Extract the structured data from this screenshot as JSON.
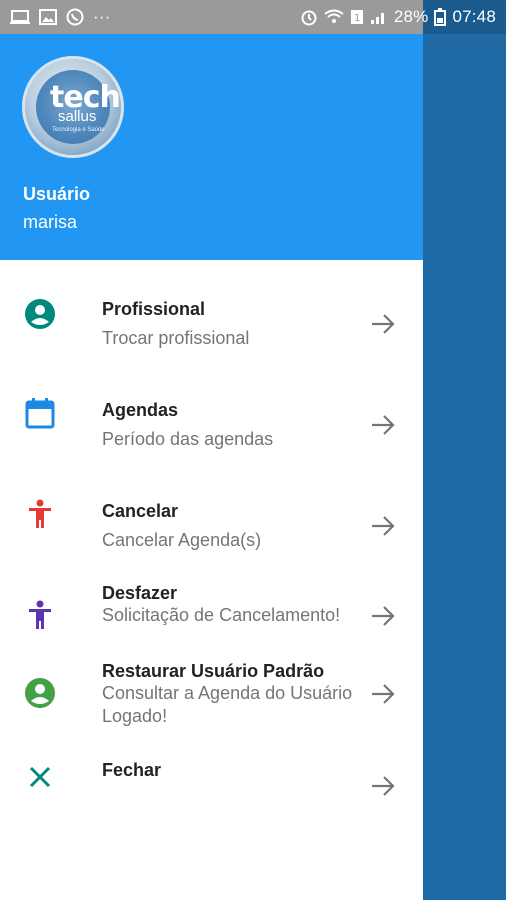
{
  "status_bar": {
    "battery": "28%",
    "time": "07:48",
    "more": "···"
  },
  "header": {
    "logo": {
      "tech": "tech",
      "sallus": "sallus",
      "tagline": "Tecnologia e Saúde"
    },
    "user_label": "Usuário",
    "user_name": "marisa"
  },
  "menu": [
    {
      "title": "Profissional",
      "subtitle": "Trocar profissional",
      "icon": "account-circle-icon",
      "color": "#00897b"
    },
    {
      "title": "Agendas",
      "subtitle": "Período das agendas",
      "icon": "calendar-icon",
      "color": "#1e88e5"
    },
    {
      "title": "Cancelar",
      "subtitle": "Cancelar Agenda(s)",
      "icon": "person-icon",
      "color": "#e53935"
    },
    {
      "title": "Desfazer",
      "subtitle": "Solicitação de Cancelamento!",
      "icon": "person-icon",
      "color": "#5e35b1"
    },
    {
      "title": "Restaurar Usuário Padrão",
      "subtitle": "Consultar a Agenda do Usuário Logado!",
      "icon": "account-circle-icon",
      "color": "#43a047"
    },
    {
      "title": "Fechar",
      "subtitle": "",
      "icon": "close-icon",
      "color": "#00897b"
    }
  ],
  "colors": {
    "header": "#2196f3",
    "scrim": "#1f6aa5",
    "arrow": "#757575"
  }
}
